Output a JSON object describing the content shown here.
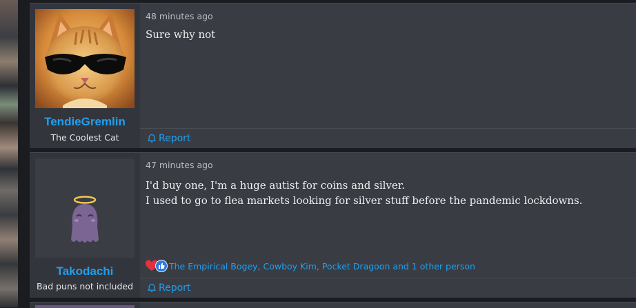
{
  "posts": [
    {
      "time": "48 minutes ago",
      "body_lines": [
        "Sure why not"
      ],
      "user": {
        "name": "TendieGremlin",
        "title": "The Coolest Cat",
        "avatar": "cat-with-sunglasses"
      },
      "report_label": "Report"
    },
    {
      "time": "47 minutes ago",
      "body_lines": [
        "I'd buy one, I'm a huge autist for coins and silver.",
        "I used to go to flea markets looking for silver stuff before the pandemic lockdowns."
      ],
      "user": {
        "name": "Takodachi",
        "title": "Bad puns not included",
        "avatar": "purple-ghost-with-halo"
      },
      "reactions": {
        "icons": [
          "heart-icon",
          "thumbs-up-icon"
        ],
        "text": "The Empirical Bogey, Cowboy Kim, Pocket Dragoon and 1 other person"
      },
      "report_label": "Report"
    }
  ],
  "colors": {
    "accent": "#1ea0f0",
    "post_bg": "#3a3c44",
    "user_col_bg": "#33353c",
    "page_bg": "#1b1c20"
  }
}
